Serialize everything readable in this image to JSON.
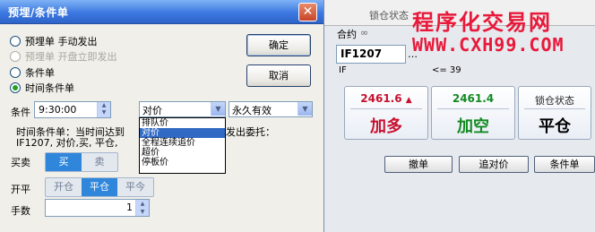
{
  "dialog": {
    "title": "预埋/条件单",
    "close": "✕",
    "options": [
      {
        "label": "预埋单  手动发出",
        "selected": false,
        "enabled": true
      },
      {
        "label": "预埋单  开盘立即发出",
        "selected": false,
        "enabled": false
      },
      {
        "label": "条件单",
        "selected": false,
        "enabled": true
      },
      {
        "label": "时间条件单",
        "selected": true,
        "enabled": true
      }
    ],
    "confirm": "确定",
    "cancel": "取消",
    "condition_label": "条件",
    "time_value": "9:30:00",
    "price_type": "对价",
    "validity": "永久有效",
    "desc_line1": "时间条件单：当时间达到",
    "desc_suffix": "发出委托：",
    "desc_line2": "IF1207, 对价,买, 平仓,",
    "dropdown_items": [
      "排队价",
      "对价",
      "全程连续追价",
      "超价",
      "停板价"
    ],
    "dropdown_selected_index": 1,
    "side_label": "买卖",
    "side_options": [
      "买",
      "卖"
    ],
    "side_selected": "买",
    "openclose_label": "开平",
    "openclose_options": [
      "开仓",
      "平仓",
      "平今"
    ],
    "openclose_selected": "平仓",
    "qty_label": "手数",
    "qty_value": "1"
  },
  "panel": {
    "head_label": "锁仓状态",
    "watermark_cn": "程序化交易网",
    "watermark_url": "WWW.CXH99.COM",
    "contract_label": "合约",
    "contract_value": "IF1207",
    "contract_short": "IF",
    "limit_text": "<= 39",
    "buy_price": "2461.6",
    "buy_arrow": "▲",
    "buy_label": "加多",
    "sell_price": "2461.4",
    "sell_label": "加空",
    "lock_title": "锁仓状态",
    "lock_label": "平仓",
    "btn_cancel_order": "撤单",
    "btn_chase": "追对价",
    "btn_condition": "条件单",
    "colors": {
      "buy": "#c8102e",
      "sell": "#138a22",
      "accent": "#2f86db"
    }
  }
}
